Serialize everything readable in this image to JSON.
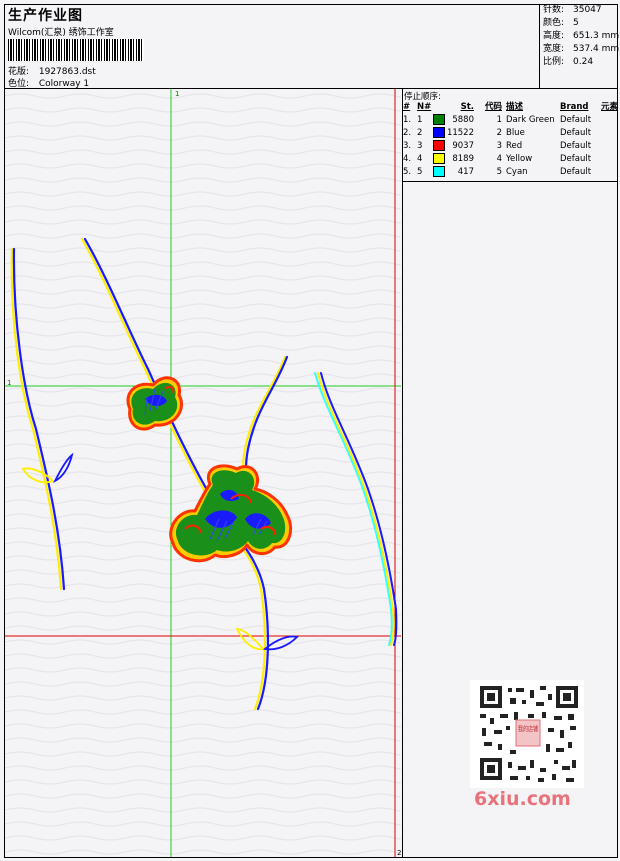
{
  "header": {
    "title": "生产作业图",
    "subtitle": "Wilcom(汇泉) 绣饰工作室",
    "design_label": "花版:",
    "design_value": "1927863.dst",
    "colorway_label": "色位:",
    "colorway_value": "Colorway 1"
  },
  "stats": [
    {
      "label": "针数:",
      "value": "35047"
    },
    {
      "label": "颜色:",
      "value": "5"
    },
    {
      "label": "高度:",
      "value": "651.3 mm"
    },
    {
      "label": "宽度:",
      "value": "537.4 mm"
    },
    {
      "label": "比例:",
      "value": "0.24"
    }
  ],
  "color_table": {
    "caption": "停止顺序:",
    "headers": [
      "#",
      "N#",
      "",
      "St.",
      "代码",
      "描述",
      "Brand",
      "元素"
    ],
    "rows": [
      {
        "idx": "1.",
        "n": "1",
        "color": "#008000",
        "stitches": "5880",
        "code": "1",
        "desc": "Dark Green",
        "brand": "Default"
      },
      {
        "idx": "2.",
        "n": "2",
        "color": "#0000ff",
        "stitches": "11522",
        "code": "2",
        "desc": "Blue",
        "brand": "Default"
      },
      {
        "idx": "3.",
        "n": "3",
        "color": "#ff0000",
        "stitches": "9037",
        "code": "3",
        "desc": "Red",
        "brand": "Default"
      },
      {
        "idx": "4.",
        "n": "4",
        "color": "#ffff00",
        "stitches": "8189",
        "code": "4",
        "desc": "Yellow",
        "brand": "Default"
      },
      {
        "idx": "5.",
        "n": "5",
        "color": "#00ffff",
        "stitches": "417",
        "code": "5",
        "desc": "Cyan",
        "brand": "Default"
      }
    ]
  },
  "guides": {
    "marker_top": "1",
    "marker_left": "1",
    "marker_bottom": "2"
  },
  "watermark": {
    "text": "6xiu.com",
    "qr_badge": "我的店铺"
  }
}
